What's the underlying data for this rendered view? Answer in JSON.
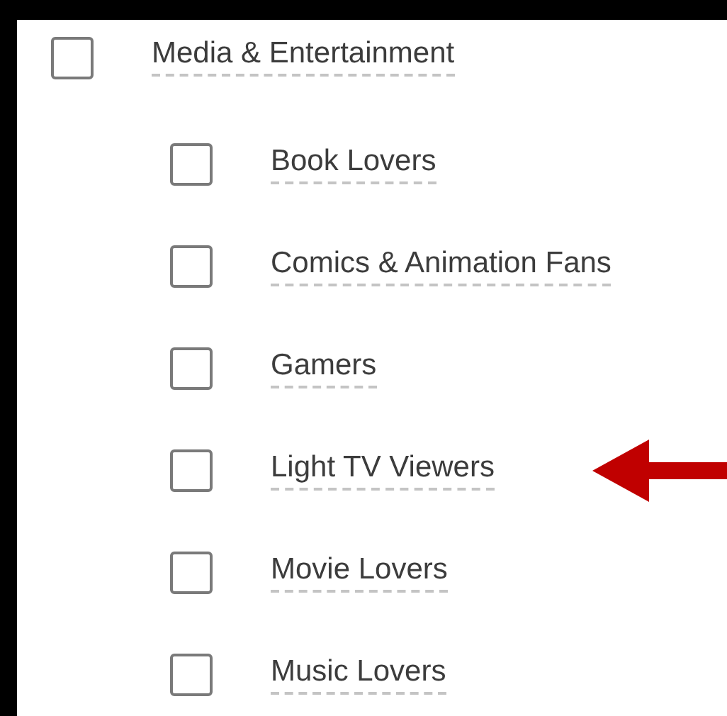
{
  "tree": [
    {
      "label": "Media & Entertainment",
      "checked": false,
      "children": [
        {
          "label": "Book Lovers",
          "checked": false,
          "pointed": false
        },
        {
          "label": "Comics & Animation Fans",
          "checked": false,
          "pointed": false
        },
        {
          "label": "Gamers",
          "checked": false,
          "pointed": false
        },
        {
          "label": "Light TV Viewers",
          "checked": false,
          "pointed": true
        },
        {
          "label": "Movie Lovers",
          "checked": false,
          "pointed": false
        },
        {
          "label": "Music Lovers",
          "checked": false,
          "pointed": false
        }
      ]
    }
  ]
}
